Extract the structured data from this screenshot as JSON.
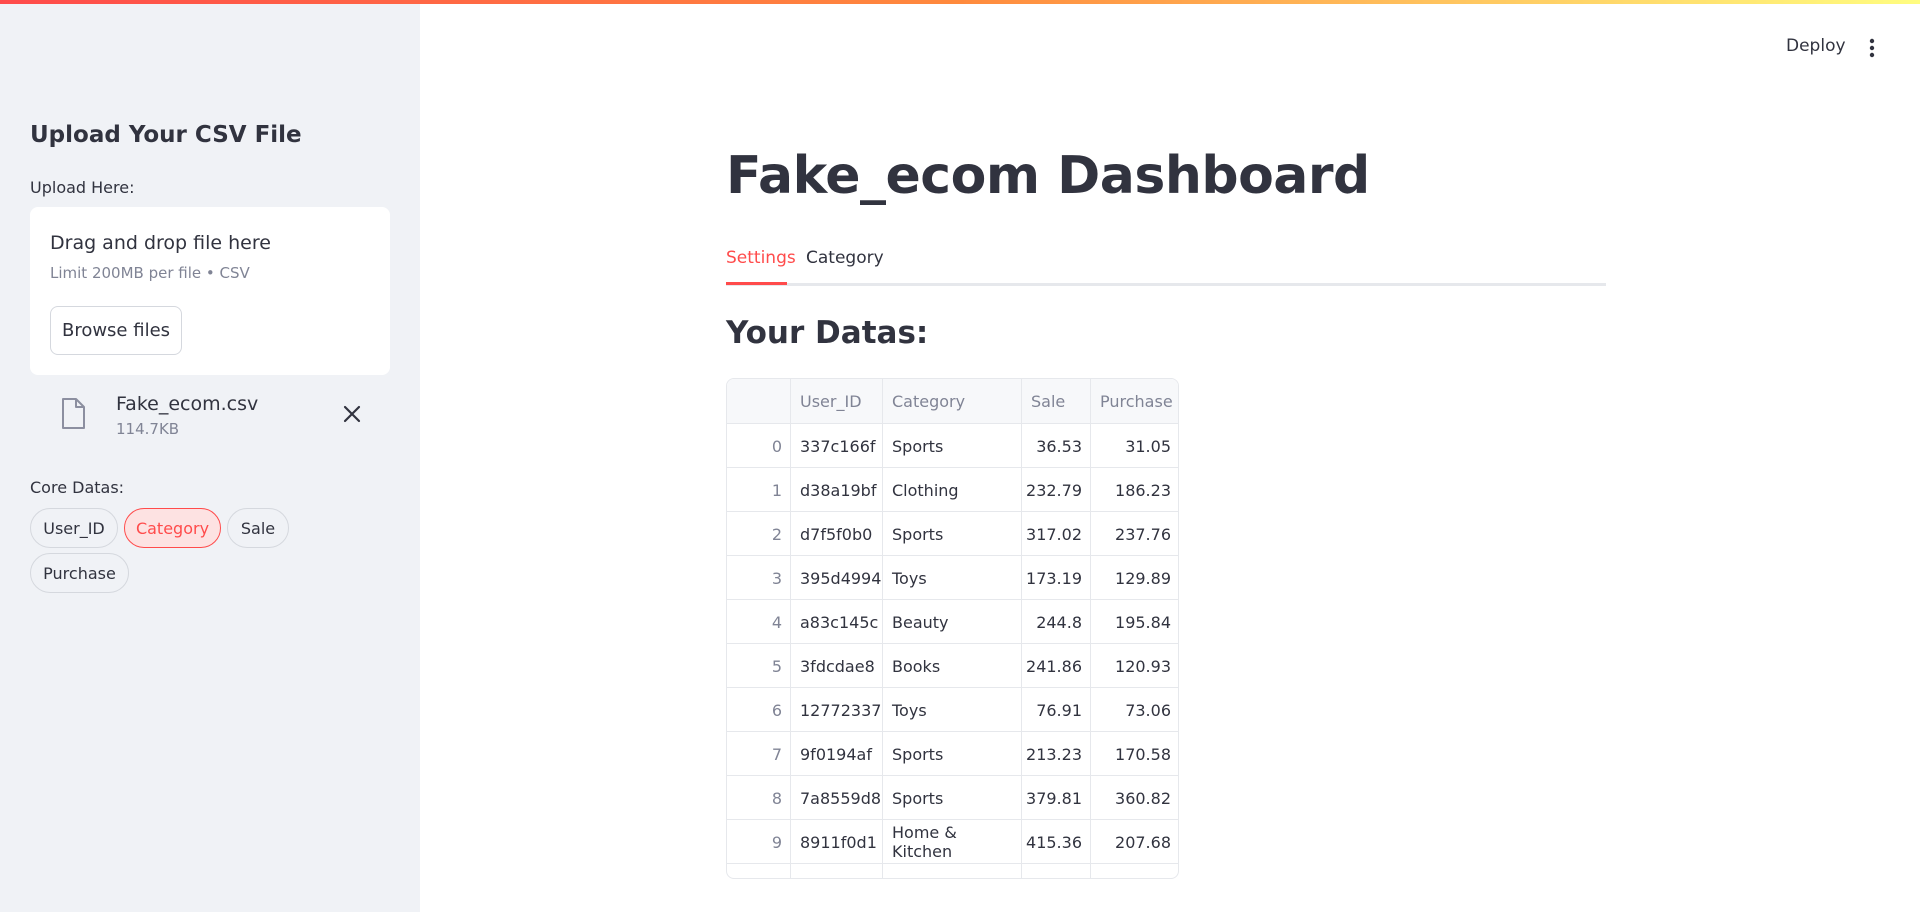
{
  "sidebar": {
    "title": "Upload Your CSV File",
    "upload_label": "Upload Here:",
    "dropzone": {
      "title": "Drag and drop file here",
      "limit": "Limit 200MB per file • CSV",
      "browse_label": "Browse files"
    },
    "file": {
      "name": "Fake_ecom.csv",
      "size": "114.7KB"
    },
    "core_label": "Core Datas:",
    "pills": [
      "User_ID",
      "Category",
      "Sale",
      "Purchase"
    ],
    "active_pill": "Category"
  },
  "header": {
    "deploy_label": "Deploy"
  },
  "main": {
    "title": "Fake_ecom Dashboard",
    "tabs": [
      "Settings",
      "Category"
    ],
    "active_tab": "Settings",
    "section_title": "Your Datas:"
  },
  "table": {
    "columns": [
      "",
      "User_ID",
      "Category",
      "Sale",
      "Purchase"
    ],
    "rows": [
      [
        "0",
        "337c166f",
        "Sports",
        "36.53",
        "31.05"
      ],
      [
        "1",
        "d38a19bf",
        "Clothing",
        "232.79",
        "186.23"
      ],
      [
        "2",
        "d7f5f0b0",
        "Sports",
        "317.02",
        "237.76"
      ],
      [
        "3",
        "395d4994",
        "Toys",
        "173.19",
        "129.89"
      ],
      [
        "4",
        "a83c145c",
        "Beauty",
        "244.8",
        "195.84"
      ],
      [
        "5",
        "3fdcdae8",
        "Books",
        "241.86",
        "120.93"
      ],
      [
        "6",
        "12772337",
        "Toys",
        "76.91",
        "73.06"
      ],
      [
        "7",
        "9f0194af",
        "Sports",
        "213.23",
        "170.58"
      ],
      [
        "8",
        "7a8559d8",
        "Sports",
        "379.81",
        "360.82"
      ],
      [
        "9",
        "8911f0d1",
        "Home & Kitchen",
        "415.36",
        "207.68"
      ]
    ]
  },
  "colors": {
    "accent": "#ff4b4b",
    "sidebar_bg": "#f0f2f6",
    "text": "#31333f",
    "muted": "#808495"
  },
  "icons": {
    "file": "file-icon",
    "close": "close-icon",
    "menu": "more-vertical-icon"
  }
}
